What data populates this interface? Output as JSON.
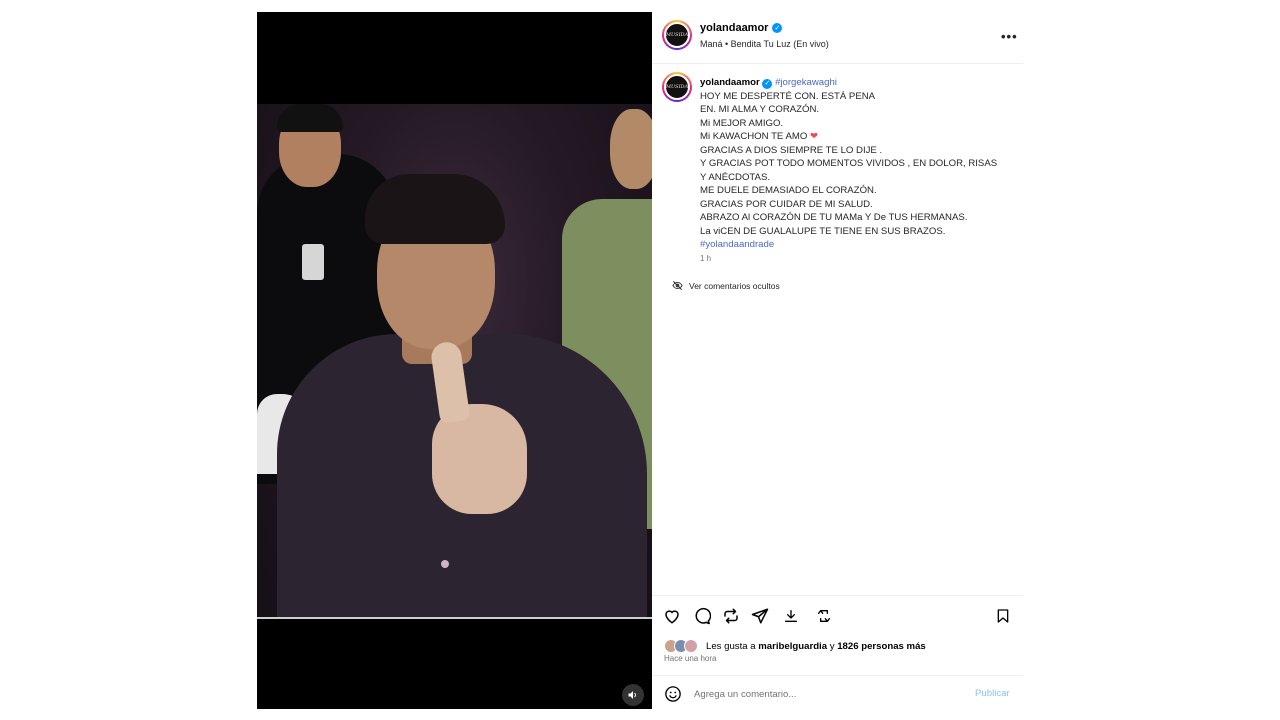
{
  "header": {
    "username": "yolandaamor",
    "audio": "Maná • Bendita Tu Luz (En vivo)",
    "avatar_text": "MUSIDA"
  },
  "caption": {
    "username": "yolandaamor",
    "mention": "#jorgekawaghi",
    "lines": [
      "HOY ME DESPERTÉ CON. ESTÁ PENA",
      "EN. MI ALMA Y CORAZÓN.",
      "Mi MEJOR AMIGO.",
      "Mi KAWACHON TE AMO",
      "GRACIAS A DIOS SIEMPRE TE LO DIJE .",
      "Y GRACIAS POT TODO MOMENTOS VIVIDOS , EN DOLOR, RISAS",
      "Y ANÉCDOTAS.",
      "ME DUELE DEMASIADO EL CORAZÓN.",
      "GRACIAS POR CUIDAR DE MI SALUD.",
      "ABRAZO Al CORAZÓN DE TU MAMa Y De TUS HERMANAS.",
      "La viCEN DE GUALALUPE TE TIENE EN SUS BRAZOS."
    ],
    "hashtag": "#yolandaandrade",
    "time": "1 h",
    "heart_glyph": "❤"
  },
  "hidden_comments": "Ver comentarios ocultos",
  "likes": {
    "prefix": "Les gusta a",
    "user": "maribelguardia",
    "conj": "y",
    "others": "1826 personas más",
    "avatar_colors": [
      "#c9a38a",
      "#7a8fb0",
      "#d4a0a8"
    ]
  },
  "posted": "Hace una hora",
  "comment": {
    "placeholder": "Agrega un comentario...",
    "publish": "Publicar"
  },
  "colors": {
    "verified": "#0095f6",
    "publish": "#85c3f8",
    "heart": "#ed4956"
  }
}
